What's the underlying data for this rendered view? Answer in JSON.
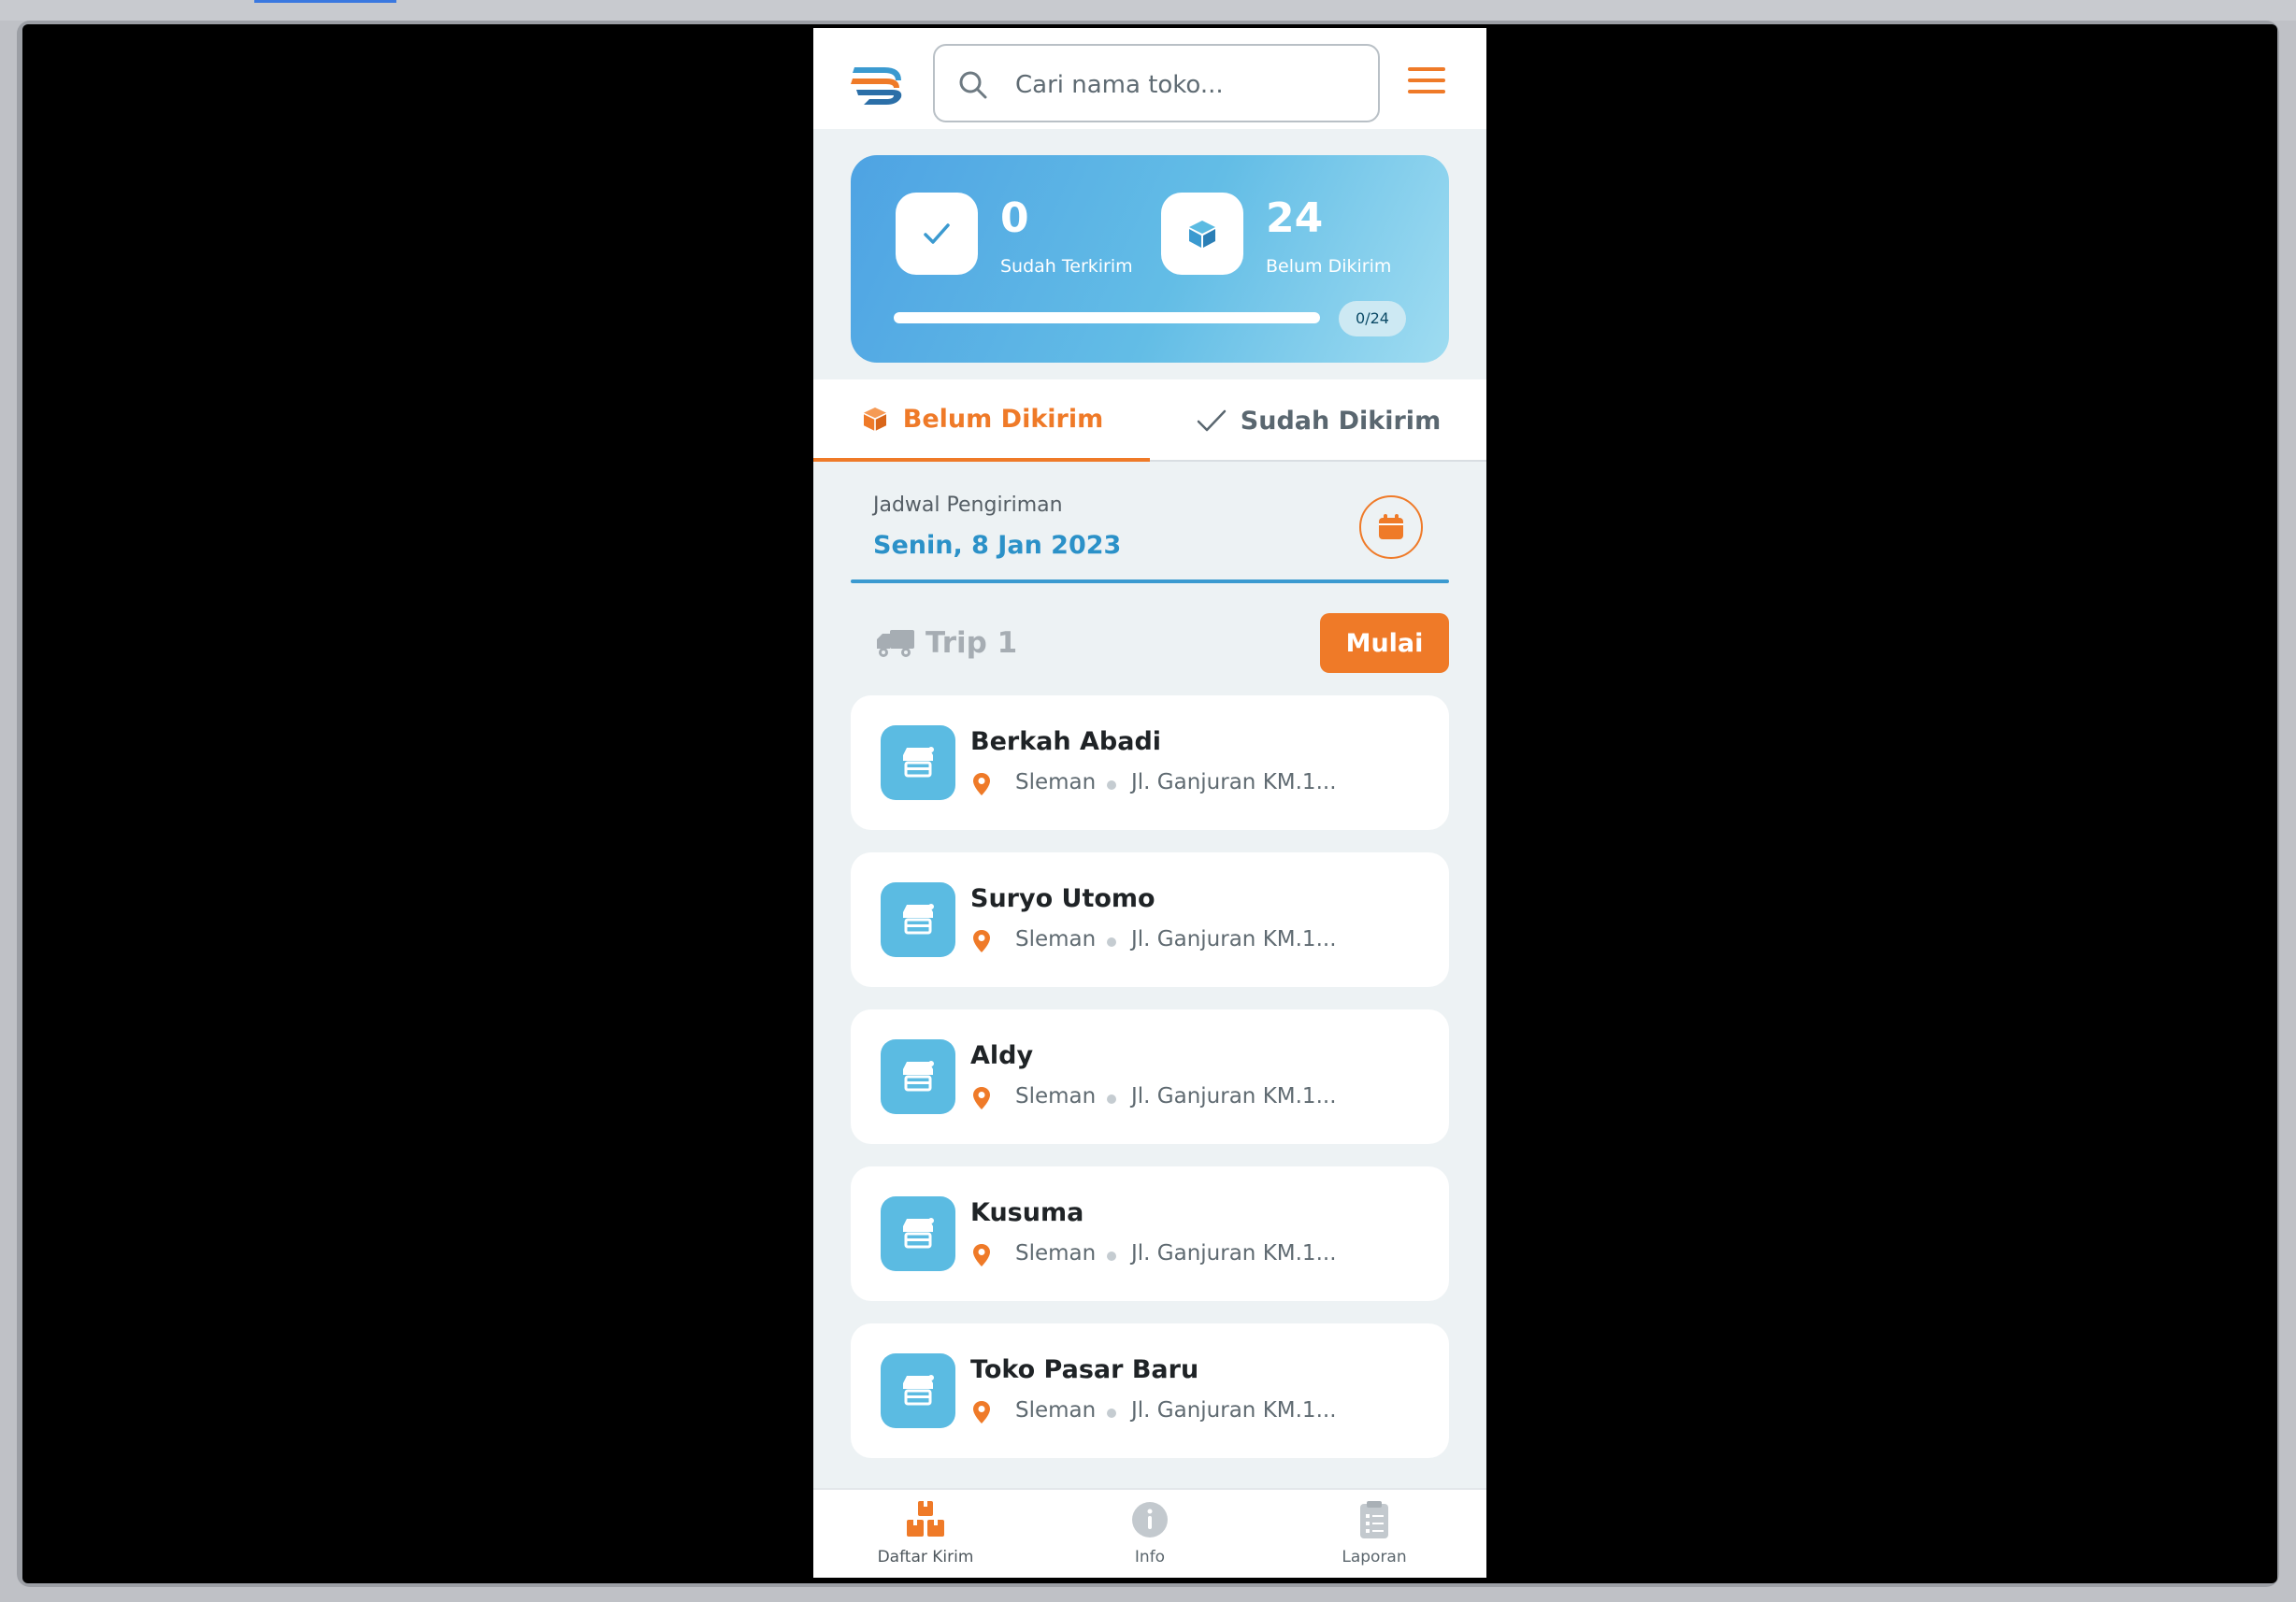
{
  "header": {
    "search_placeholder": "Cari nama toko..."
  },
  "summary": {
    "delivered_count": "0",
    "delivered_label": "Sudah Terkirim",
    "pending_count": "24",
    "pending_label": "Belum Dikirim",
    "progress_text": "0/24",
    "progress_fraction": 0
  },
  "tabs": [
    {
      "label": "Belum Dikirim",
      "active": true
    },
    {
      "label": "Sudah Dikirim",
      "active": false
    }
  ],
  "schedule": {
    "label": "Jadwal Pengiriman",
    "date": "Senin, 8 Jan 2023"
  },
  "trip": {
    "label": "Trip 1",
    "start_label": "Mulai"
  },
  "stores": [
    {
      "name": "Berkah Abadi",
      "region": "Sleman",
      "address": "Jl. Ganjuran KM.1..."
    },
    {
      "name": "Suryo Utomo",
      "region": "Sleman",
      "address": "Jl. Ganjuran KM.1..."
    },
    {
      "name": "Aldy",
      "region": "Sleman",
      "address": "Jl. Ganjuran KM.1..."
    },
    {
      "name": "Kusuma",
      "region": "Sleman",
      "address": "Jl. Ganjuran KM.1..."
    },
    {
      "name": "Toko Pasar Baru",
      "region": "Sleman",
      "address": "Jl. Ganjuran KM.1..."
    }
  ],
  "bottom_nav": [
    {
      "label": "Daftar Kirim",
      "icon": "boxes-icon",
      "active": true
    },
    {
      "label": "Info",
      "icon": "info-icon",
      "active": false
    },
    {
      "label": "Laporan",
      "icon": "clipboard-icon",
      "active": false
    }
  ],
  "colors": {
    "accent": "#ef7a28",
    "primary_blue": "#2b91c8",
    "store_icon_bg": "#5bbbe2"
  }
}
